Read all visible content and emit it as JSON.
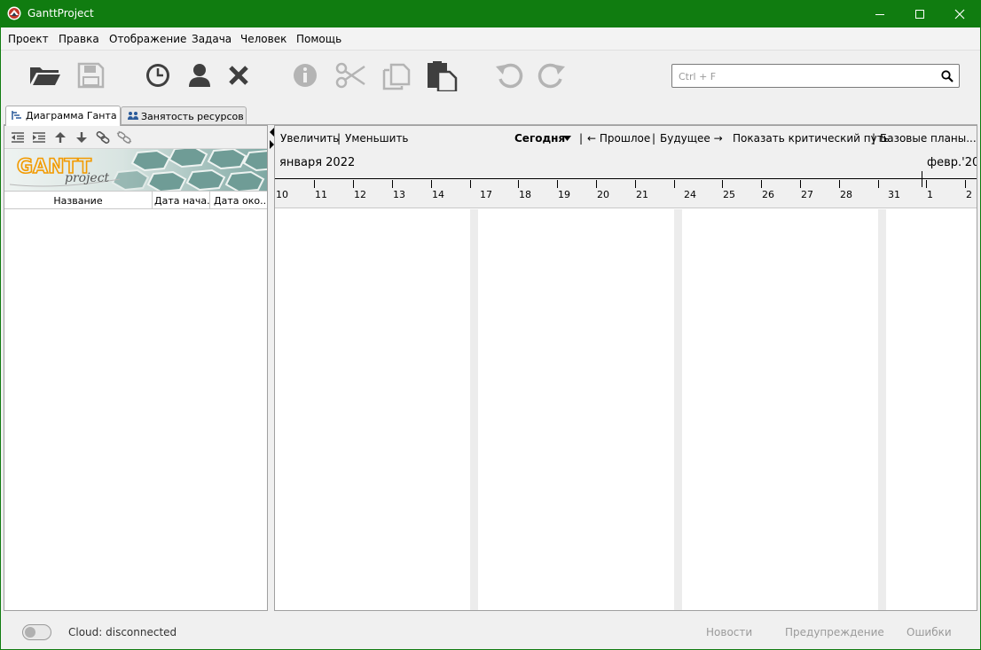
{
  "window": {
    "title": "GanttProject",
    "controls": {
      "minimize": "minimize-icon",
      "maximize": "maximize-icon",
      "close": "close-icon"
    }
  },
  "menu": [
    {
      "label": "Проект"
    },
    {
      "label": "Правка"
    },
    {
      "label": "Отображение"
    },
    {
      "label": "Задача"
    },
    {
      "label": "Человек"
    },
    {
      "label": "Помощь"
    }
  ],
  "toolbar": {
    "buttons": [
      {
        "name": "open-project-button",
        "icon": "folder-open-icon",
        "enabled": true
      },
      {
        "name": "save-project-button",
        "icon": "floppy-disk-icon",
        "enabled": false
      },
      {
        "name": "new-task-button",
        "icon": "clock-icon",
        "enabled": true
      },
      {
        "name": "new-resource-button",
        "icon": "person-icon",
        "enabled": true
      },
      {
        "name": "delete-button",
        "icon": "cross-icon",
        "enabled": true
      },
      {
        "name": "properties-button",
        "icon": "info-icon",
        "enabled": false
      },
      {
        "name": "cut-button",
        "icon": "scissors-icon",
        "enabled": false
      },
      {
        "name": "copy-button",
        "icon": "copy-icon",
        "enabled": false
      },
      {
        "name": "paste-button",
        "icon": "paste-icon",
        "enabled": true
      },
      {
        "name": "undo-button",
        "icon": "undo-icon",
        "enabled": false
      },
      {
        "name": "redo-button",
        "icon": "redo-icon",
        "enabled": false
      }
    ]
  },
  "search": {
    "placeholder": "Ctrl + F",
    "value": "",
    "icon": "search-icon"
  },
  "tabs": [
    {
      "label": "Диаграмма Ганта",
      "icon": "gantt-chart-icon",
      "active": true
    },
    {
      "label": "Занятость ресурсов",
      "icon": "resource-load-icon",
      "active": false
    }
  ],
  "task_panel": {
    "tools": [
      {
        "name": "outdent-button",
        "icon": "outdent-icon"
      },
      {
        "name": "indent-button",
        "icon": "indent-icon"
      },
      {
        "name": "move-up-button",
        "icon": "arrow-up-icon"
      },
      {
        "name": "move-down-button",
        "icon": "arrow-down-icon"
      },
      {
        "name": "link-button",
        "icon": "link-icon"
      },
      {
        "name": "unlink-button",
        "icon": "unlink-icon"
      }
    ],
    "logo": {
      "word": "GANTT",
      "subword": "project"
    },
    "columns": [
      "Название",
      "Дата нача...",
      "Дата око..."
    ],
    "rows": []
  },
  "gantt_toolbar": {
    "zoom_in": "Увеличить",
    "zoom_out": "Уменьшить",
    "today": "Сегодня",
    "past": "← Прошлое",
    "future": "Будущее →",
    "critical_path": "Показать критический путь",
    "baselines": "Базовые планы...",
    "separators": [
      "|",
      "|",
      "|",
      "|"
    ]
  },
  "timeline": {
    "months": [
      "января 2022",
      "февр.'20"
    ],
    "days": [
      "10",
      "11",
      "12",
      "13",
      "14",
      "17",
      "18",
      "19",
      "20",
      "21",
      "24",
      "25",
      "26",
      "27",
      "28",
      "31",
      "1",
      "2"
    ]
  },
  "statusbar": {
    "cloud_status": "Cloud: disconnected",
    "cloud_enabled": false,
    "links": [
      "Новости",
      "Предупреждение",
      "Ошибки"
    ]
  },
  "colors": {
    "titlebar": "#107c10",
    "icon_enabled": "#3f3f3f",
    "icon_disabled": "#b4b4b4",
    "logo_orange": "#f29a00",
    "logo_teal": "#6f9c96"
  }
}
